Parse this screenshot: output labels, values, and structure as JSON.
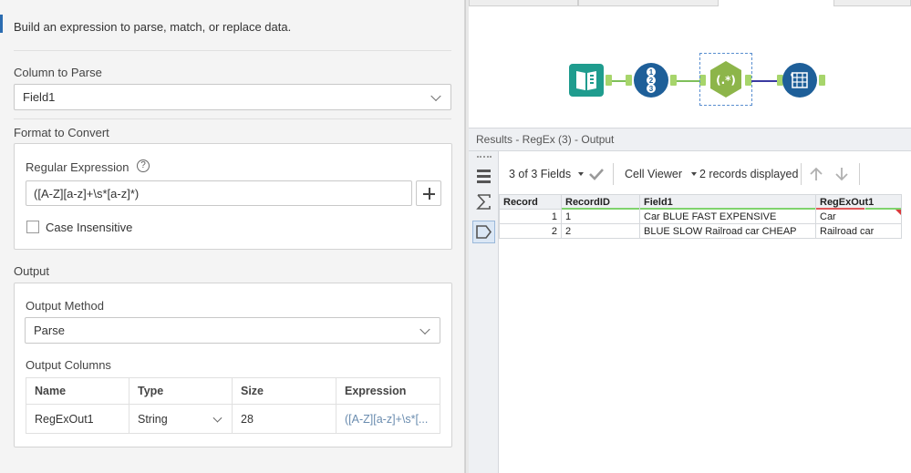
{
  "config": {
    "intro": "Build an expression to parse, match, or replace data.",
    "column_to_parse": {
      "label": "Column to Parse",
      "value": "Field1"
    },
    "format_to_convert": {
      "label": "Format to Convert",
      "regex_label": "Regular Expression",
      "help_glyph": "?",
      "regex_value": "([A-Z][a-z]+\\s*[a-z]*)",
      "case_insensitive_label": "Case Insensitive",
      "case_insensitive_checked": false
    },
    "output": {
      "label": "Output",
      "method_label": "Output Method",
      "method_value": "Parse",
      "columns_label": "Output Columns",
      "headers": [
        "Name",
        "Type",
        "Size",
        "Expression"
      ],
      "rows": [
        {
          "name": "RegExOut1",
          "type": "String",
          "size": "28",
          "expression": "([A-Z][a-z]+\\s*[..."
        }
      ]
    }
  },
  "workflow": {
    "tools": [
      {
        "name": "Input Data",
        "icon": "book-icon",
        "color": "#1f9c8e"
      },
      {
        "name": "Record ID",
        "icon": "record-id-icon",
        "color": "#1e5f99",
        "glyphs": [
          "1",
          "2",
          "3"
        ]
      },
      {
        "name": "RegEx",
        "icon": "regex-icon",
        "color": "#8db54a",
        "glyph": "(.*)"
      },
      {
        "name": "Browse",
        "icon": "browse-icon",
        "color": "#1e5f99"
      }
    ]
  },
  "results": {
    "header": "Results - RegEx (3) - Output",
    "fields_selector": "3 of 3 Fields",
    "cell_viewer": "Cell Viewer",
    "records_displayed": "2 records displayed",
    "columns": [
      "Record",
      "RecordID",
      "Field1",
      "RegExOut1"
    ],
    "rows": [
      {
        "record": "1",
        "recordid": "1",
        "field1": "Car BLUE FAST EXPENSIVE",
        "regexout1": "Car"
      },
      {
        "record": "2",
        "recordid": "2",
        "field1": "BLUE SLOW Railroad car CHEAP",
        "regexout1": "Railroad car"
      }
    ]
  }
}
